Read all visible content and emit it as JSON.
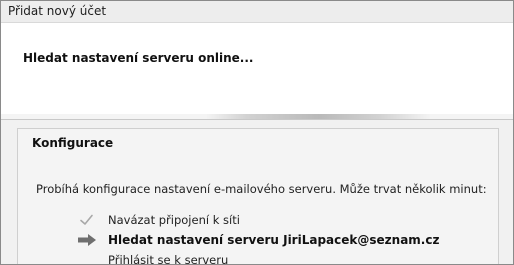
{
  "window": {
    "title": "Přidat nový účet"
  },
  "header": {
    "title": "Hledat nastavení serveru online..."
  },
  "config": {
    "section_title": "Konfigurace",
    "description": "Probíhá konfigurace nastavení e-mailového serveru. Může trvat několik minut:",
    "steps": [
      {
        "label": "Navázat připojení k síti",
        "status": "done",
        "icon": "checkmark-icon"
      },
      {
        "label": "Hledat nastavení serveru JiriLapacek@seznam.cz",
        "status": "current",
        "icon": "arrow-right-icon"
      },
      {
        "label": "Přihlásit se k serveru",
        "status": "pending",
        "icon": "none"
      }
    ]
  },
  "colors": {
    "checkmark": "#a8a8a8",
    "arrow": "#707070"
  }
}
